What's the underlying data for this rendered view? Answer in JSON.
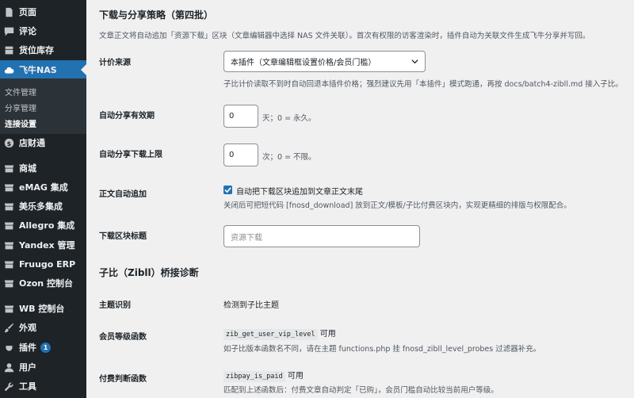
{
  "sidebar": {
    "items": [
      {
        "label": "页面",
        "icon": "page-icon"
      },
      {
        "label": "评论",
        "icon": "comment-icon"
      },
      {
        "label": "货位库存",
        "icon": "inventory-icon"
      },
      {
        "label": "飞牛NAS",
        "icon": "cloud-icon"
      },
      {
        "label": "店财通",
        "icon": "dollar-icon"
      },
      {
        "label": "商城",
        "icon": "store-icon"
      },
      {
        "label": "eMAG 集成",
        "icon": "store-icon"
      },
      {
        "label": "美乐多集成",
        "icon": "store-icon"
      },
      {
        "label": "Allegro 集成",
        "icon": "store-icon"
      },
      {
        "label": "Yandex 管理",
        "icon": "store-icon"
      },
      {
        "label": "Fruugo ERP",
        "icon": "store-icon"
      },
      {
        "label": "Ozon 控制台",
        "icon": "store-icon"
      },
      {
        "label": "WB 控制台",
        "icon": "store-icon"
      },
      {
        "label": "外观",
        "icon": "brush-icon"
      },
      {
        "label": "插件",
        "icon": "plugin-icon",
        "badge": "1"
      },
      {
        "label": "用户",
        "icon": "user-icon"
      },
      {
        "label": "工具",
        "icon": "wrench-icon"
      }
    ],
    "submenu": [
      "文件管理",
      "分享管理",
      "连接设置"
    ]
  },
  "section1": {
    "title": "下载与分享策略（第四批）",
    "intro": "文章正文将自动追加「资源下载」区块（文章编辑器中选择 NAS 文件关联）。首次有权限的访客渲染时，插件自动为关联文件生成飞牛分享并写回。",
    "pricing": {
      "label": "计价来源",
      "selected": "本插件（文章编辑框设置价格/会员门槛）",
      "help": "子比计价读取不到时自动回退本插件价格；强烈建议先用「本插件」模式跑通，再按 docs/batch4-zibll.md 接入子比。"
    },
    "expiry": {
      "label": "自动分享有效期",
      "value": "0",
      "suffix": "天；0 = 永久。"
    },
    "limit": {
      "label": "自动分享下载上限",
      "value": "0",
      "suffix": "次；0 = 不限。"
    },
    "append": {
      "label": "正文自动追加",
      "checkbox_label": "自动把下载区块追加到文章正文末尾",
      "help": "关闭后可把短代码 [fnosd_download] 放到正文/模板/子比付费区块内，实现更精细的排版与权限配合。"
    },
    "block_title": {
      "label": "下载区块标题",
      "placeholder": "资源下载"
    }
  },
  "section2": {
    "title": "子比（Zibll）桥接诊断",
    "theme": {
      "label": "主题识别",
      "value": "检测到子比主题"
    },
    "vip": {
      "label": "会员等级函数",
      "code": "zib_get_user_vip_level",
      "status": "可用",
      "help": "如子比版本函数名不同，请在主题 functions.php 挂 fnosd_zibll_level_probes 过滤器补充。"
    },
    "paid": {
      "label": "付费判断函数",
      "code": "zibpay_is_paid",
      "status": "可用",
      "help": "匹配到上述函数后：付费文章自动判定「已购」，会员门槛自动比较当前用户等级。"
    }
  },
  "colors": {
    "accent": "#2271b1",
    "sidebar": "#1d2327"
  }
}
